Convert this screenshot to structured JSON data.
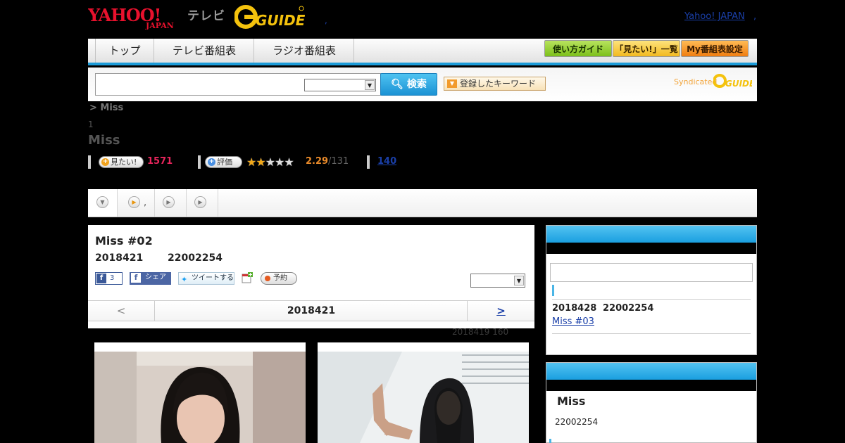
{
  "header": {
    "brand_yahoo": "YAHOO! JAPAN",
    "brand_terebi": "テレビ",
    "brand_gguide": "G GUIDE",
    "dot": ",",
    "yahoo_japan_link": "Yahoo! JAPAN",
    "dot2": ","
  },
  "nav": {
    "tabs": [
      "トップ",
      "テレビ番組表",
      "ラジオ番組表"
    ],
    "util_buttons": [
      "使い方ガイド",
      "「見たい!」一覧",
      "My番組表設定"
    ]
  },
  "search": {
    "input_value": "",
    "select_value": "",
    "button_label": "検索",
    "saved_keywords_label": "登録したキーワード",
    "syndicated_label": "Syndicated"
  },
  "program": {
    "breadcrumb": "> Miss",
    "count_small": "1",
    "title": "Miss",
    "mitai_label": "見たい!",
    "mitai_count": "1571",
    "rating_label": "評価",
    "rating_stars": 2.29,
    "rating_value": "2.29",
    "rating_count": "/131",
    "review_link": "140"
  },
  "tabs": [
    {
      "label": ""
    },
    {
      "label": ","
    },
    {
      "label": ""
    },
    {
      "label": ""
    }
  ],
  "episode": {
    "title": "Miss #02",
    "date": "2018421",
    "time": "22002254",
    "fb_like_count": "3",
    "fb_share_label": "シェア",
    "tweet_label": "ツイートする",
    "reserve_label": "予約",
    "select_value": "",
    "prev_label": "<",
    "nav_date": "2018421",
    "next_label": ">"
  },
  "photo_caption": "2018419  160",
  "sidebar": {
    "next_date": "2018428",
    "next_time": "22002254",
    "next_link": "Miss #03  ",
    "program_title": "Miss",
    "program_time": "22002254"
  },
  "colors": {
    "accent_blue": "#1b9bd8",
    "link_blue": "#1a3fa8",
    "mitai_pink": "#e8255c",
    "rating_orange": "#e88a2a"
  }
}
